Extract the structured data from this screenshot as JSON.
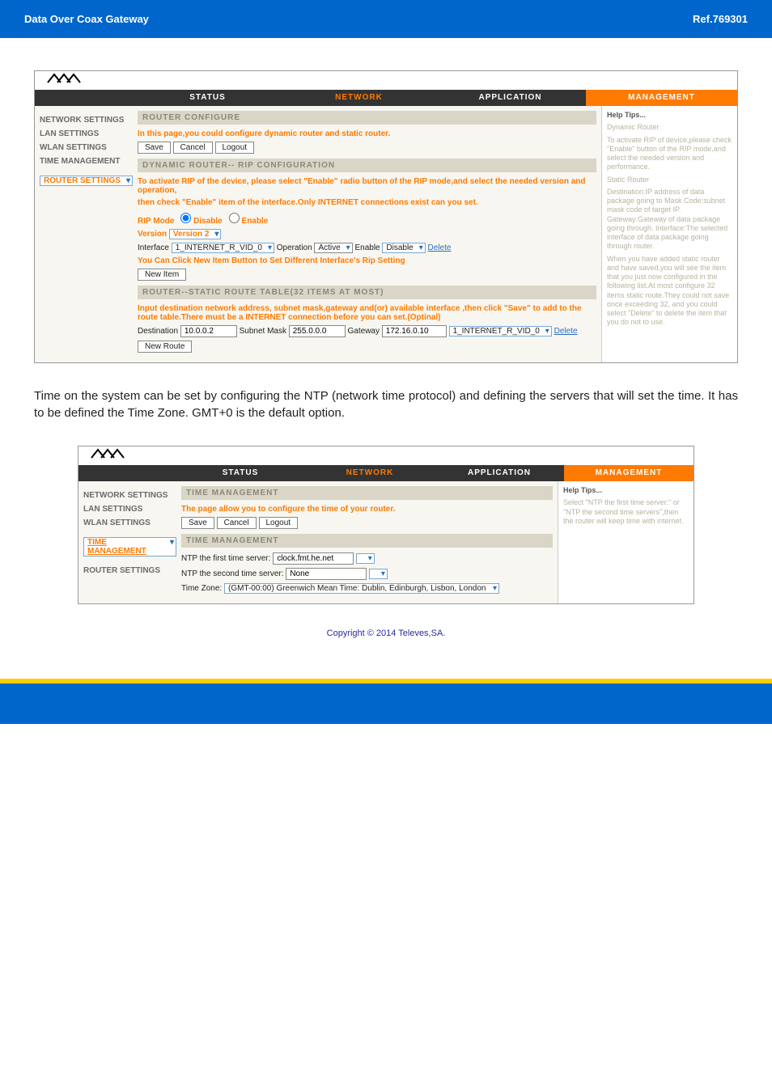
{
  "header": {
    "title": "Data Over Coax Gateway",
    "ref": "Ref.769301"
  },
  "router_ui": {
    "tabs": {
      "status": "STATUS",
      "network": "NETWORK",
      "application": "APPLICATION",
      "management": "MANAGEMENT"
    },
    "side": {
      "net": "NETWORK SETTINGS",
      "lan": "LAN SETTINGS",
      "wlan": "WLAN SETTINGS",
      "time": "TIME MANAGEMENT",
      "router": "ROUTER SETTINGS"
    },
    "b1": "ROUTER CONFIGURE",
    "p1": "In this page,you could configure dynamic router and static router.",
    "btn": {
      "save": "Save",
      "cancel": "Cancel",
      "logout": "Logout",
      "newitem": "New Item",
      "newroute": "New Route"
    },
    "b2": "DYNAMIC ROUTER-- RIP CONFIGURATION",
    "p2a": "To activate RIP of the device, please select \"Enable\" radio button of the RIP mode,and select the needed version and operation,",
    "p2b": "then check \"Enable\" item of the interface.Only INTERNET connections exist can you set.",
    "rip_mode_label": "RIP Mode",
    "rip_disable": "Disable",
    "rip_enable": "Enable",
    "ver_label": "Version",
    "ver_val": "Version 2",
    "if_label": "Interface",
    "if_val": "1_INTERNET_R_VID_0",
    "op_label": "Operation",
    "op_val": "Active",
    "op_en": "Enable",
    "op_dis": "Disable",
    "del": "Delete",
    "p3": "You Can Click New Item Button to Set Different Interface's Rip Setting",
    "b3": "ROUTER--STATIC ROUTE TABLE(32 ITEMS AT MOST)",
    "p4": "Input destination network address, subnet mask,gateway and(or) available interface ,then click \"Save\" to add to the route table.There must be a INTERNET connection before you can set.(Optinal)",
    "dst_label": "Destination",
    "dst": "10.0.0.2",
    "mask_label": "Subnet Mask",
    "mask": "255.0.0.0",
    "gw_label": "Gateway",
    "gw": "172.16.0.10",
    "if2": "1_INTERNET_R_VID_0",
    "help": {
      "t": "Help Tips...",
      "h1": "Dynamic Router",
      "h1t": "To activate RIP of device,please check \"Enable\" button of the RIP mode,and select the needed version and performance.",
      "h2": "Static Router",
      "h2t": "Destination:IP address of data package going to Mask Code:subnet mask code of target IP. Gateway:Gateway of data package going through. Interface:The selected interface of data package going through router.",
      "h3t": "When you have added static router and have saved,you will see the item that you just now configured in the following list.At most configure 32 items static route.They could not save once exceeding 32, and you could select \"Delete\" to delete the item that you do not to use."
    }
  },
  "desc": "Time on the system can be set by configuring the NTP (network time protocol) and defining the servers that will set the time. It has to be defined the Time Zone. GMT+0 is the default option.",
  "time_ui": {
    "b1": "TIME MANAGEMENT",
    "p1": "The page allow you to configure the time of your router.",
    "ntp1_label": "NTP the first time server:",
    "ntp1": "clock.fmt.he.net",
    "ntp2_label": "NTP the second time server:",
    "ntp2": "None",
    "tz_label": "Time Zone:",
    "tz": "(GMT-00:00) Greenwich Mean Time: Dublin, Edinburgh, Lisbon, London",
    "help": {
      "t": "Help Tips...",
      "txt": "Select \"NTP the first time server:\" or \"NTP the second time servers\",then the router will keep time with internet."
    }
  },
  "copy": "Copyright © 2014 Televes,SA."
}
